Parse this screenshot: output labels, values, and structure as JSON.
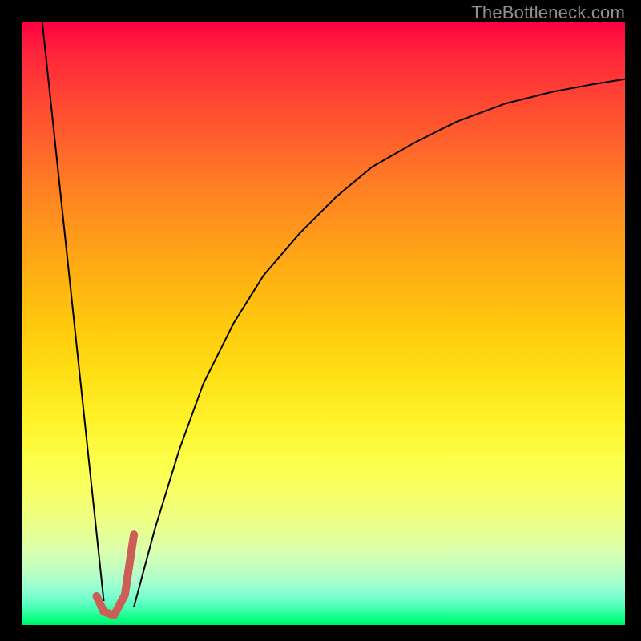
{
  "watermark": "TheBottleneck.com",
  "chart_data": {
    "type": "line",
    "title": "",
    "xlabel": "",
    "ylabel": "",
    "xlim": [
      0,
      100
    ],
    "ylim": [
      0,
      100
    ],
    "grid": false,
    "background_gradient": {
      "top_color": "#ff0040",
      "bottom_color": "#00ea6c",
      "note": "vertical red→orange→yellow→green gradient representing bottleneck severity (top=high, bottom=low)"
    },
    "series": [
      {
        "name": "left-descent",
        "color": "#000000",
        "stroke_width": 2,
        "x": [
          3.3,
          13.5
        ],
        "values": [
          100,
          4
        ]
      },
      {
        "name": "right-curve",
        "color": "#000000",
        "stroke_width": 2,
        "x": [
          18.5,
          22,
          26,
          30,
          35,
          40,
          46,
          52,
          58,
          65,
          72,
          80,
          88,
          95,
          100
        ],
        "values": [
          3,
          16,
          29,
          40,
          50,
          58,
          65,
          71,
          76,
          80,
          83.5,
          86.5,
          88.5,
          89.8,
          90.6
        ]
      },
      {
        "name": "optimal-hook",
        "color": "#cc5e57",
        "stroke_width": 10,
        "stroke_linecap": "round",
        "x": [
          12.3,
          13.5,
          15.2,
          17.0,
          18.5
        ],
        "values": [
          4.8,
          2.2,
          1.6,
          5.0,
          15.0
        ]
      }
    ],
    "annotations": []
  }
}
